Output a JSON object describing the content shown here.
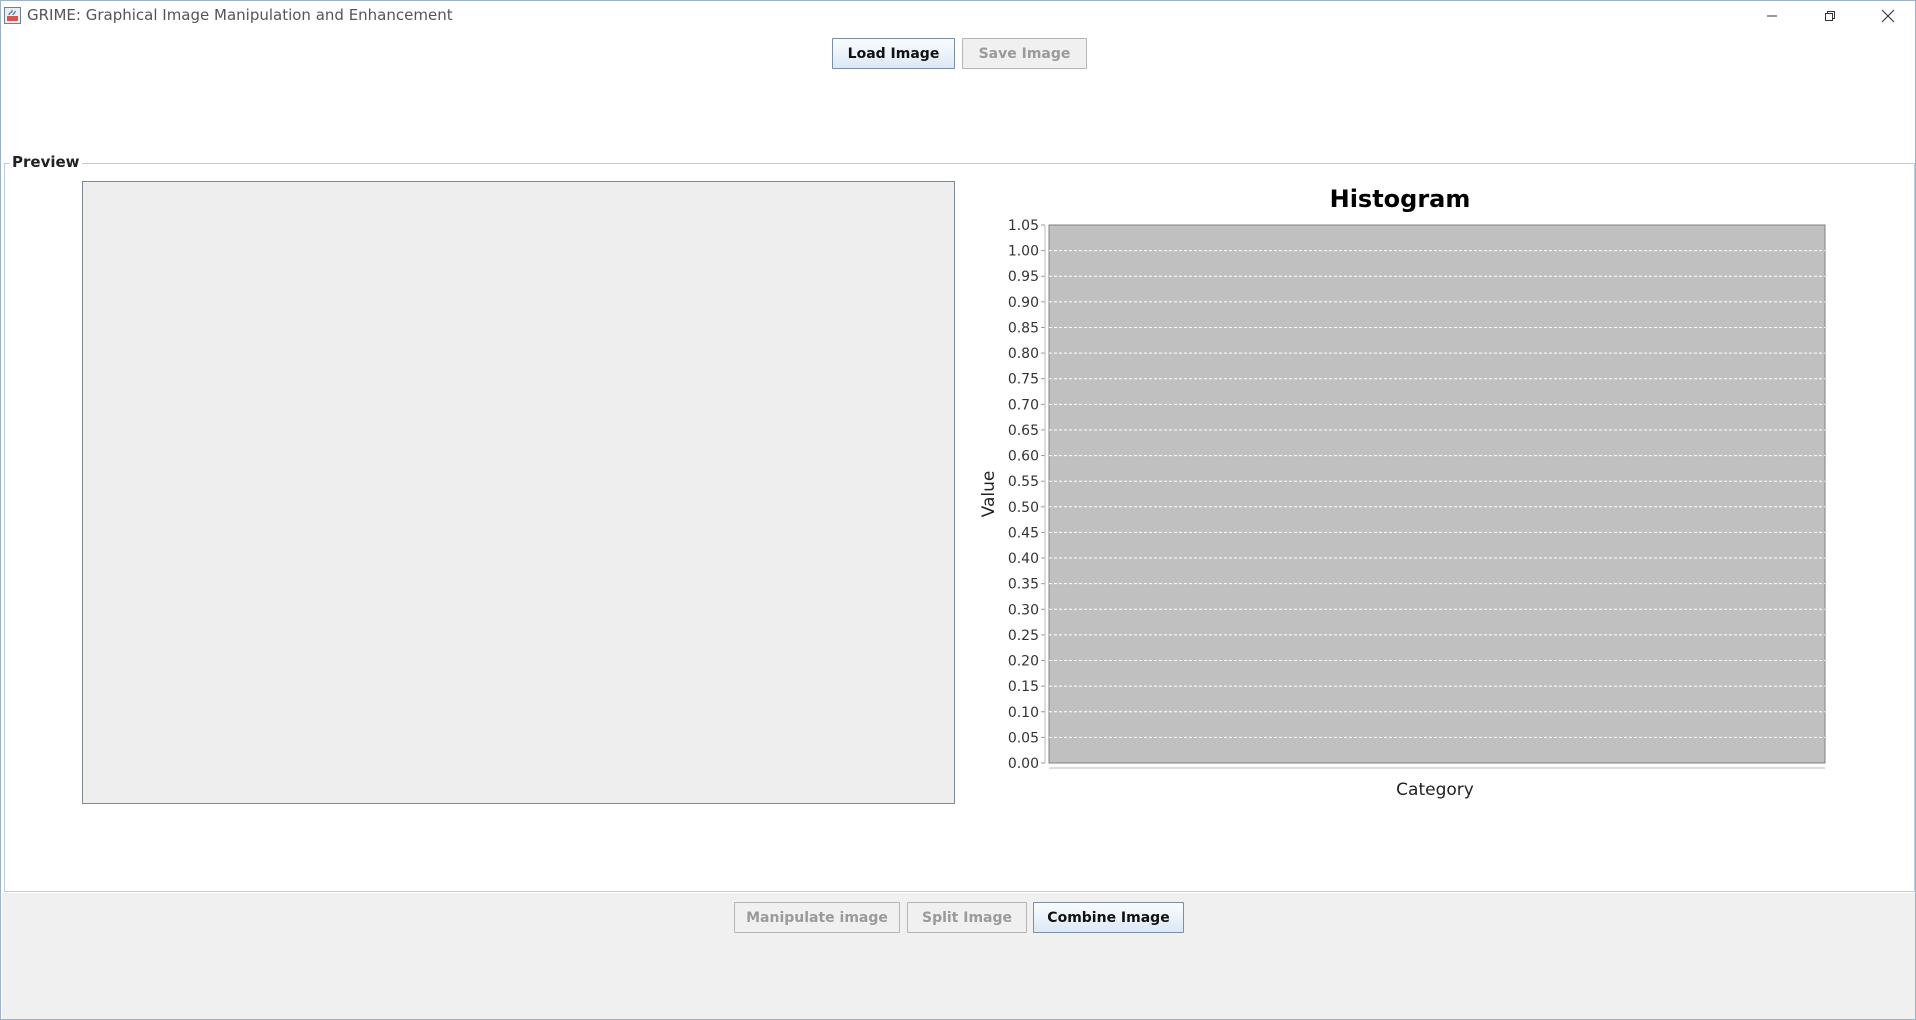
{
  "window": {
    "title": "GRIME: Graphical Image Manipulation and Enhancement",
    "controls": [
      "minimize-icon",
      "restore-icon",
      "close-icon"
    ]
  },
  "toolbar": {
    "load_label": "Load Image",
    "save_label": "Save Image"
  },
  "preview": {
    "title": "Preview"
  },
  "bottom": {
    "manipulate_label": "Manipulate image",
    "split_label": "Split Image",
    "combine_label": "Combine Image"
  },
  "chart_data": {
    "type": "bar",
    "title": "Histogram",
    "xlabel": "Category",
    "ylabel": "Value",
    "categories": [],
    "series": [],
    "ylim": [
      0,
      1.05
    ],
    "yticks": [
      "0.00",
      "0.05",
      "0.10",
      "0.15",
      "0.20",
      "0.25",
      "0.30",
      "0.35",
      "0.40",
      "0.45",
      "0.50",
      "0.55",
      "0.60",
      "0.65",
      "0.70",
      "0.75",
      "0.80",
      "0.85",
      "0.90",
      "0.95",
      "1.00",
      "1.05"
    ],
    "grid": true,
    "plot_background": "#c0c0c0",
    "grid_color": "#ffffff"
  }
}
